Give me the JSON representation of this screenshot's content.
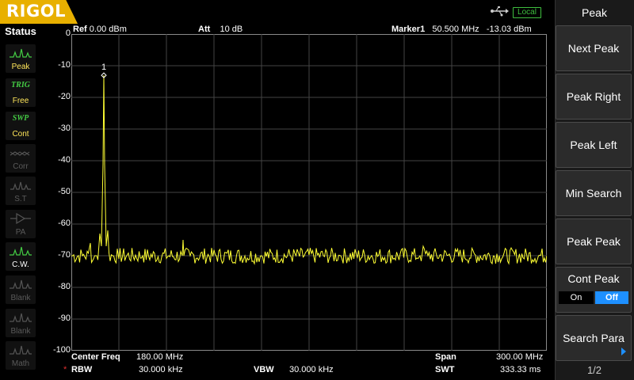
{
  "brand": "RIGOL",
  "top": {
    "local_label": "Local"
  },
  "status": {
    "title": "Status",
    "items": [
      {
        "top": "",
        "label": "Peak",
        "state": "on",
        "icon": "peak-icon"
      },
      {
        "top": "TRIG",
        "label": "Free",
        "state": "on",
        "icon": ""
      },
      {
        "top": "SWP",
        "label": "Cont",
        "state": "on",
        "icon": ""
      },
      {
        "top": "",
        "label": "Corr",
        "state": "off",
        "icon": "corr-icon"
      },
      {
        "top": "",
        "label": "S.T",
        "state": "off",
        "icon": "source-tracking-icon"
      },
      {
        "top": "",
        "label": "PA",
        "state": "off",
        "icon": "preamp-icon"
      },
      {
        "top": "",
        "label": "C.W.",
        "state": "on-white",
        "icon": "cw-icon"
      },
      {
        "top": "",
        "label": "Blank",
        "state": "off",
        "icon": "trace-icon"
      },
      {
        "top": "",
        "label": "Blank",
        "state": "off",
        "icon": "trace-icon"
      },
      {
        "top": "",
        "label": "Math",
        "state": "off",
        "icon": "trace-icon"
      }
    ]
  },
  "header": {
    "ref_label": "Ref",
    "ref_value": "0.00 dBm",
    "att_label": "Att",
    "att_value": "10 dB",
    "marker_label": "Marker1",
    "marker_freq": "50.500 MHz",
    "marker_amp": "-13.03 dBm"
  },
  "y_axis_labels": [
    "0",
    "-10",
    "-20",
    "-30",
    "-40",
    "-50",
    "-60",
    "-70",
    "-80",
    "-90",
    "-100"
  ],
  "marker_number": "1",
  "footer": {
    "center_freq_label": "Center Freq",
    "center_freq_value": "180.00 MHz",
    "span_label": "Span",
    "span_value": "300.00 MHz",
    "rbw_star": "*",
    "rbw_label": "RBW",
    "rbw_value": "30.000 kHz",
    "vbw_label": "VBW",
    "vbw_value": "30.000 kHz",
    "swt_label": "SWT",
    "swt_value": "333.33 ms"
  },
  "menu": {
    "title": "Peak",
    "next_peak": "Next Peak",
    "peak_right": "Peak Right",
    "peak_left": "Peak Left",
    "min_search": "Min Search",
    "peak_peak": "Peak Peak",
    "cont_peak": "Cont Peak",
    "cont_on": "On",
    "cont_off": "Off",
    "search_para": "Search Para",
    "page": "1/2"
  },
  "colors": {
    "trace": "#ffff33",
    "brand": "#e8b000",
    "grid": "#444444",
    "selected": "#1e90ff"
  },
  "chart_data": {
    "type": "line",
    "title": "",
    "xlabel": "",
    "ylabel": "",
    "x_unit": "MHz",
    "y_unit": "dBm",
    "xlim": [
      30,
      330
    ],
    "ylim": [
      -100,
      0
    ],
    "grid": true,
    "noise_floor_db": -70,
    "series": [
      {
        "x": [
          30,
          37,
          42,
          44,
          46,
          48,
          49,
          50,
          50.5,
          51,
          52,
          53,
          56,
          60,
          75,
          100,
          100.5,
          101,
          105,
          150,
          200,
          250,
          252,
          255,
          300,
          330
        ],
        "y": [
          -70,
          -70,
          -66,
          -71,
          -70,
          -63,
          -67,
          -41,
          -13.03,
          -41,
          -67,
          -62,
          -70,
          -71,
          -70,
          -70,
          -65,
          -70,
          -70,
          -70,
          -70,
          -70,
          -67,
          -70,
          -70,
          -70
        ]
      }
    ],
    "marker": {
      "id": "1",
      "x": 50.5,
      "y": -13.03
    }
  }
}
